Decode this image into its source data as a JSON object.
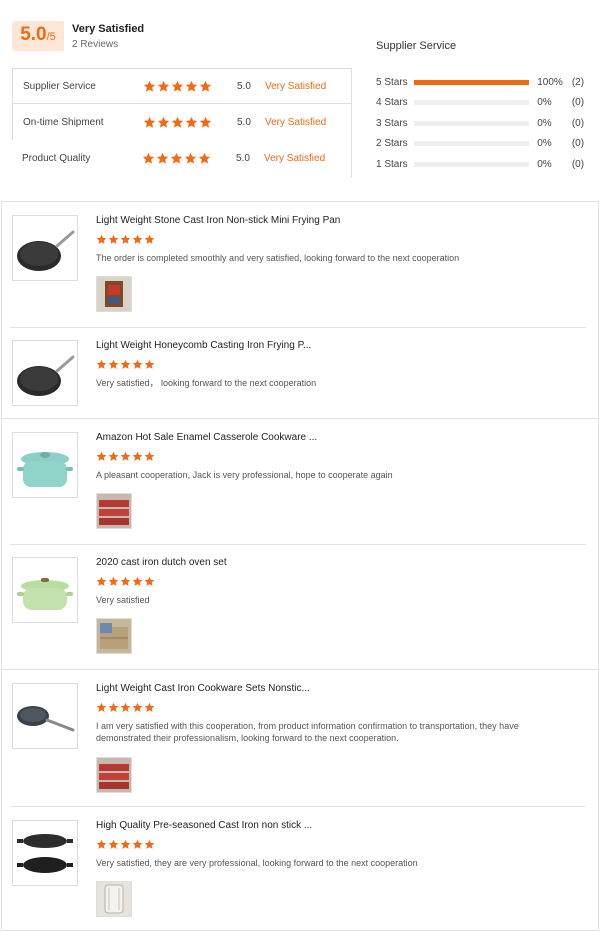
{
  "summary": {
    "score": "5.0",
    "score_max": "/5",
    "overall_label": "Very Satisfied",
    "review_count": "2 Reviews",
    "ratings": [
      {
        "label": "Supplier Service",
        "stars": 5,
        "score": "5.0",
        "text": "Very Satisfied"
      },
      {
        "label": "On-time Shipment",
        "stars": 5,
        "score": "5.0",
        "text": "Very Satisfied"
      },
      {
        "label": "Product Quality",
        "stars": 5,
        "score": "5.0",
        "text": "Very Satisfied"
      }
    ]
  },
  "service_breakdown": {
    "title": "Supplier Service",
    "rows": [
      {
        "label": "5 Stars",
        "fraction": 1.0,
        "pct": "100%",
        "count": "(2)"
      },
      {
        "label": "4 Stars",
        "fraction": 0,
        "pct": "0%",
        "count": "(0)"
      },
      {
        "label": "3 Stars",
        "fraction": 0,
        "pct": "0%",
        "count": "(0)"
      },
      {
        "label": "2 Stars",
        "fraction": 0,
        "pct": "0%",
        "count": "(0)"
      },
      {
        "label": "1 Stars",
        "fraction": 0,
        "pct": "0%",
        "count": "(0)"
      }
    ]
  },
  "reviews": [
    {
      "title": "Light Weight Stone Cast Iron Non-stick Mini Frying Pan",
      "stars": 5,
      "comment": "The order is completed smoothly and very satisfied, looking forward to the next cooperation",
      "thumb_icon": "frying-pan",
      "photo_icon": "box-photo"
    },
    {
      "title": "Light Weight Honeycomb Casting Iron Frying P...",
      "stars": 5,
      "comment": "Very satisfied， looking forward to the next cooperation",
      "thumb_icon": "frying-pan",
      "photo_icon": ""
    },
    {
      "title": "Amazon Hot Sale Enamel Casserole Cookware ...",
      "stars": 5,
      "comment": "A pleasant cooperation, Jack is very professional, hope to cooperate again",
      "thumb_icon": "casserole-teal",
      "photo_icon": "red-pots-photo"
    },
    {
      "title": "2020 cast iron dutch oven set",
      "stars": 5,
      "comment": "Very satisfied",
      "thumb_icon": "dutch-oven-green",
      "photo_icon": "carton-photo"
    },
    {
      "title": "Light Weight Cast Iron Cookware Sets Nonstic...",
      "stars": 5,
      "comment": "I am very satisfied with this cooperation, from product information confirmation to transportation, they have demonstrated their professionalism, looking forward to the next cooperation.",
      "thumb_icon": "skillet-long",
      "photo_icon": "red-pots-photo"
    },
    {
      "title": "High Quality Pre-seasoned Cast Iron non stick ...",
      "stars": 5,
      "comment": "Very satisfied, they are very professional, looking forward to the next cooperation",
      "thumb_icon": "griddle-pans",
      "photo_icon": "wrapped-photo"
    }
  ],
  "colors": {
    "accent": "#ee6b16",
    "star": "#f26a16",
    "score_bg": "#fde6d6"
  }
}
